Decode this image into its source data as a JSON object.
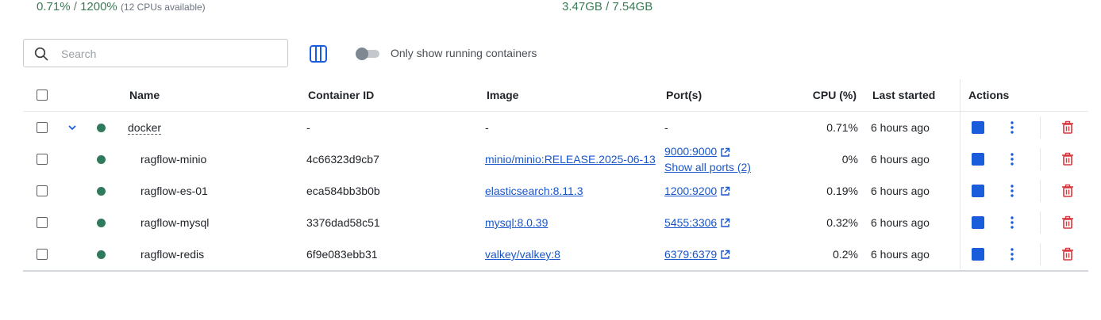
{
  "stats": {
    "cpu_value": "0.71%",
    "cpu_sep": " / ",
    "cpu_total": "1200%",
    "cpu_note": "(12 CPUs available)",
    "mem_used": "3.47GB",
    "mem_sep": " / ",
    "mem_total": "7.54GB"
  },
  "search": {
    "placeholder": "Search"
  },
  "toggle": {
    "label": "Only show running containers",
    "on": false
  },
  "headers": {
    "name": "Name",
    "container_id": "Container ID",
    "image": "Image",
    "ports": "Port(s)",
    "cpu": "CPU (%)",
    "last_started": "Last started",
    "actions": "Actions"
  },
  "rows": [
    {
      "name": "docker",
      "container_id": "-",
      "image": "-",
      "port": "-",
      "port_extra": "",
      "cpu": "0.71%",
      "last_started": "6 hours ago"
    },
    {
      "name": "ragflow-minio",
      "container_id": "4c66323d9cb7",
      "image": "minio/minio:RELEASE.2025-06-13",
      "port": "9000:9000",
      "port_extra": "Show all ports (2)",
      "cpu": "0%",
      "last_started": "6 hours ago"
    },
    {
      "name": "ragflow-es-01",
      "container_id": "eca584bb3b0b",
      "image": "elasticsearch:8.11.3",
      "port": "1200:9200",
      "port_extra": "",
      "cpu": "0.19%",
      "last_started": "6 hours ago"
    },
    {
      "name": "ragflow-mysql",
      "container_id": "3376dad58c51",
      "image": "mysql:8.0.39",
      "port": "5455:3306",
      "port_extra": "",
      "cpu": "0.32%",
      "last_started": "6 hours ago"
    },
    {
      "name": "ragflow-redis",
      "container_id": "6f9e083ebb31",
      "image": "valkey/valkey:8",
      "port": "6379:6379",
      "port_extra": "",
      "cpu": "0.2%",
      "last_started": "6 hours ago"
    }
  ],
  "colors": {
    "accent": "#1a5ddb",
    "running": "#2f7a5a",
    "danger": "#d9363e",
    "stat": "#3a7a55",
    "link": "#1a56c9"
  },
  "icons": {
    "search": "search-icon",
    "columns": "columns-icon",
    "expand": "chevron-down-icon",
    "stop": "stop-icon",
    "more": "more-vert-icon",
    "delete": "trash-icon",
    "external": "external-link-icon"
  }
}
